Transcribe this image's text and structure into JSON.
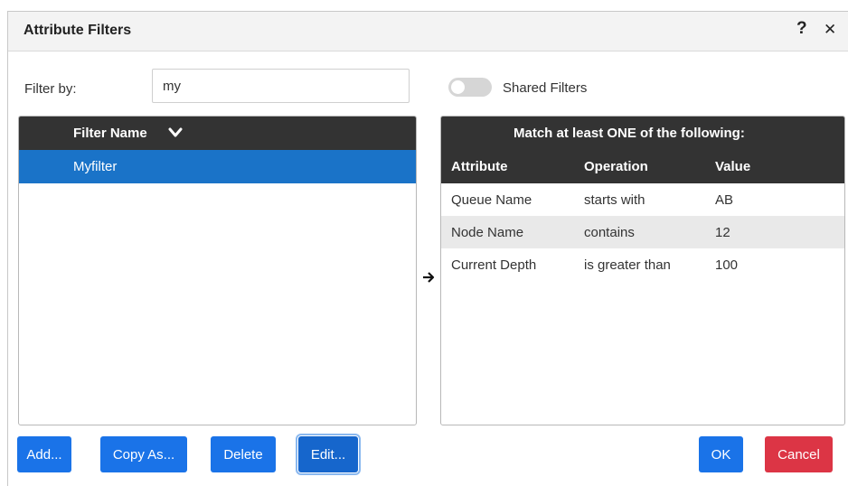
{
  "dialog": {
    "title": "Attribute Filters",
    "help_icon": "?",
    "close_icon": "✕"
  },
  "filter": {
    "label": "Filter by:",
    "value": "my"
  },
  "shared_filters": {
    "label": "Shared Filters",
    "enabled": false
  },
  "filter_list": {
    "header": "Filter Name",
    "sort_icon": "chevron-down-icon",
    "items": [
      {
        "name": "Myfilter",
        "selected": true
      }
    ]
  },
  "rules": {
    "match_label": "Match at least ONE of the following:",
    "columns": [
      "Attribute",
      "Operation",
      "Value"
    ],
    "rows": [
      {
        "attribute": "Queue Name",
        "operation": "starts with",
        "value": "AB"
      },
      {
        "attribute": "Node Name",
        "operation": "contains",
        "value": "12"
      },
      {
        "attribute": "Current Depth",
        "operation": "is greater than",
        "value": "100"
      }
    ]
  },
  "buttons": {
    "add": "Add...",
    "copy_as": "Copy As...",
    "delete": "Delete",
    "edit": "Edit...",
    "ok": "OK",
    "cancel": "Cancel"
  },
  "colors": {
    "primary": "#1a73e8",
    "danger": "#dc3545",
    "header_dark": "#333333",
    "selected_row": "#1a73c8"
  }
}
